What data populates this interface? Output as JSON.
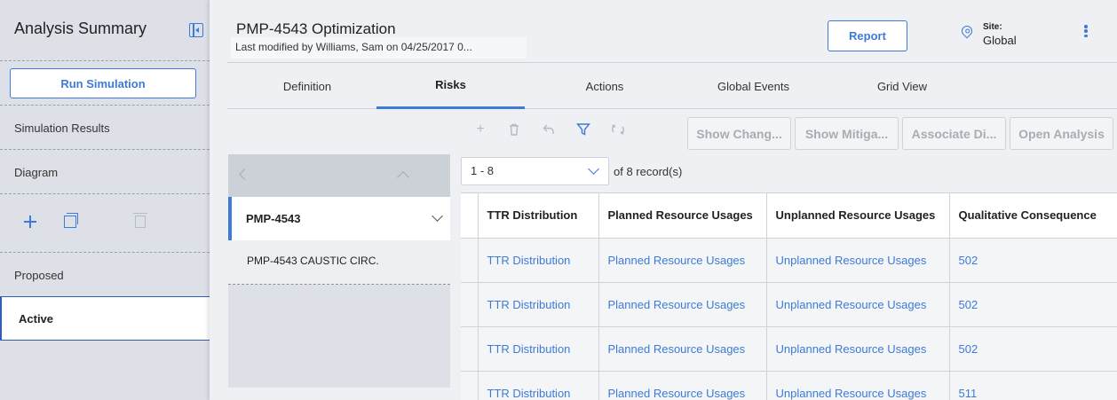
{
  "sidebar": {
    "title": "Analysis Summary",
    "run_button": "Run Simulation",
    "items": [
      "Simulation Results",
      "Diagram",
      "Proposed",
      "Active"
    ]
  },
  "header": {
    "title": "PMP-4543 Optimization",
    "modified": "Last modified by Williams, Sam on 04/25/2017 0...",
    "report_button": "Report",
    "site_label": "Site:",
    "site_value": "Global"
  },
  "tabs": [
    {
      "label": "Definition",
      "selected": false
    },
    {
      "label": "Risks",
      "selected": true
    },
    {
      "label": "Actions",
      "selected": false
    },
    {
      "label": "Global Events",
      "selected": false
    },
    {
      "label": "Grid View",
      "selected": false
    }
  ],
  "toolbar": {
    "icons": [
      "add-icon",
      "delete-icon",
      "undo-icon",
      "filter-icon",
      "refresh-icon"
    ],
    "buttons": [
      "Show Chang...",
      "Show Mitiga...",
      "Associate Di...",
      "Open Analysis"
    ]
  },
  "list": {
    "selected": "PMP-4543",
    "items": [
      "PMP-4543 CAUSTIC CIRC."
    ]
  },
  "grid": {
    "range": "1 - 8",
    "records_text": "of 8 record(s)",
    "columns": [
      "",
      "TTR Distribution",
      "Planned Resource Usages",
      "Unplanned Resource Usages",
      "Qualitative Consequence"
    ],
    "rows": [
      [
        "",
        "TTR Distribution",
        "Planned Resource Usages",
        "Unplanned Resource Usages",
        "502"
      ],
      [
        "",
        "TTR Distribution",
        "Planned Resource Usages",
        "Unplanned Resource Usages",
        "502"
      ],
      [
        "",
        "TTR Distribution",
        "Planned Resource Usages",
        "Unplanned Resource Usages",
        "502"
      ],
      [
        "",
        "TTR Distribution",
        "Planned Resource Usages",
        "Unplanned Resource Usages",
        "511"
      ]
    ]
  },
  "colors": {
    "accent": "#3d7bd6",
    "sidebar_bg": "#dde1e7",
    "content_bg": "#eef0f3"
  }
}
